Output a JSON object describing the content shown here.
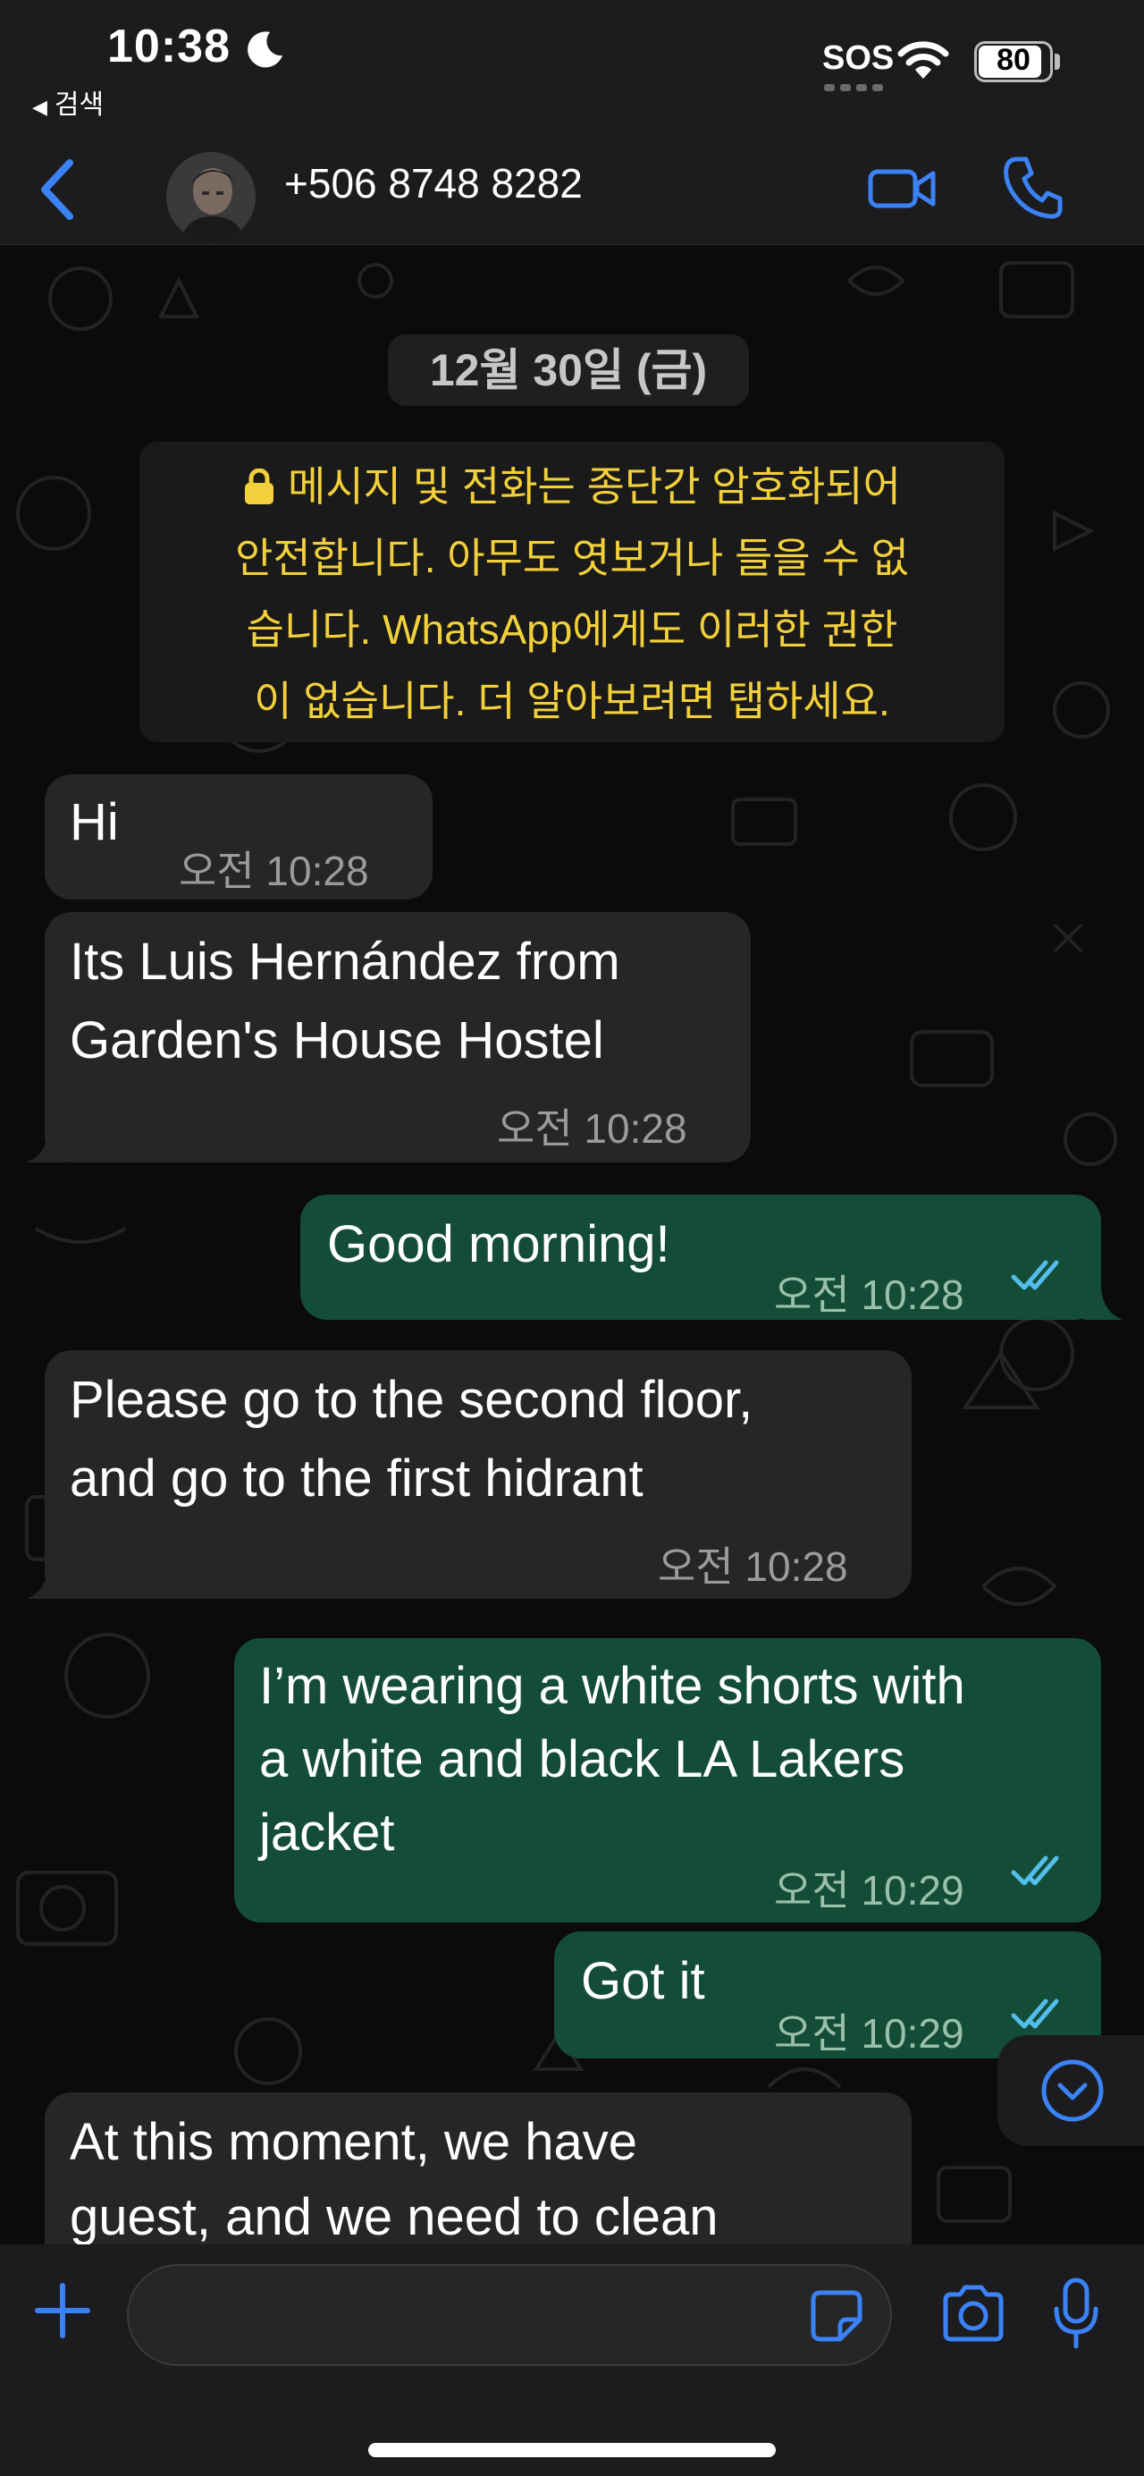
{
  "status_bar": {
    "time": "10:38",
    "back_to_app": "검색",
    "sos": "SOS",
    "battery": "80"
  },
  "header": {
    "contact": "+506 8748 8282"
  },
  "chat": {
    "date": "12월 30일 (금)",
    "encryption_notice": {
      "line1": "메시지 및 전화는 종단간 암호화되어",
      "line2": "안전합니다. 아무도 엿보거나 들을 수 없",
      "line3": "습니다. WhatsApp에게도 이러한 권한",
      "line4": "이 없습니다. 더 알아보려면 탭하세요."
    },
    "messages": [
      {
        "direction": "in",
        "lines": [
          "Hi"
        ],
        "time": "오전 10:28"
      },
      {
        "direction": "in",
        "lines": [
          "Its Luis Hernández from",
          "Garden's House Hostel"
        ],
        "time": "오전 10:28"
      },
      {
        "direction": "out",
        "lines": [
          "Good morning!"
        ],
        "time": "오전 10:28",
        "status": "read"
      },
      {
        "direction": "in",
        "lines": [
          "Please go to the second floor,",
          "and go to the first hidrant"
        ],
        "time": "오전 10:28"
      },
      {
        "direction": "out",
        "lines": [
          "I’m wearing a white shorts with",
          "a white and black LA Lakers",
          "jacket"
        ],
        "time": "오전 10:29",
        "status": "read"
      },
      {
        "direction": "out",
        "lines": [
          "Got it"
        ],
        "time": "오전 10:29",
        "status": "read"
      },
      {
        "direction": "in",
        "lines": [
          "At this moment, we have",
          "guest, and we need to clean"
        ],
        "time": ""
      }
    ]
  },
  "input": {
    "placeholder": ""
  },
  "colors": {
    "accent": "#3b82f6",
    "incoming_bubble": "#262626",
    "outgoing_bubble": "#144d37",
    "read_ticks": "#53bdeb",
    "notice_text": "#f2d03b"
  },
  "icons": {
    "back": "chevron-left-icon",
    "video": "video-camera-icon",
    "call": "phone-icon",
    "attach": "plus-icon",
    "sticker": "sticker-icon",
    "camera": "camera-icon",
    "mic": "microphone-icon",
    "scroll": "chevron-down-circle-icon"
  }
}
